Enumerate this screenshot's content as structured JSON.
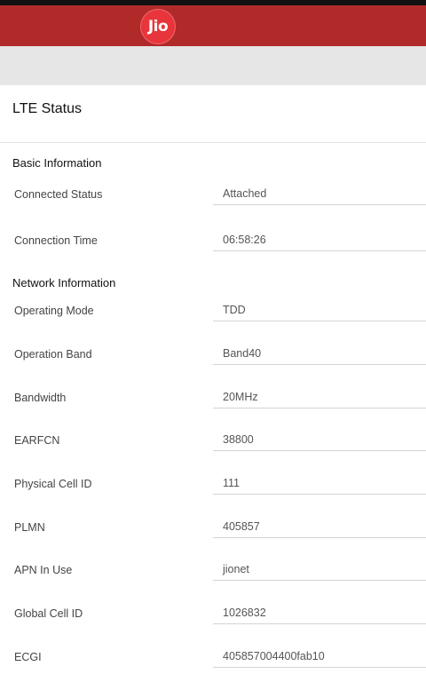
{
  "header": {
    "logo_text": "Jio",
    "brand_color": "#b12a2a",
    "logo_color": "#e8353b"
  },
  "page": {
    "title": "LTE Status"
  },
  "sections": {
    "basic": {
      "title": "Basic Information",
      "rows": [
        {
          "label": "Connected Status",
          "value": "Attached"
        },
        {
          "label": "Connection Time",
          "value": "06:58:26"
        }
      ]
    },
    "network": {
      "title": "Network Information",
      "rows": [
        {
          "label": "Operating Mode",
          "value": "TDD"
        },
        {
          "label": "Operation Band",
          "value": "Band40"
        },
        {
          "label": "Bandwidth",
          "value": "20MHz"
        },
        {
          "label": "EARFCN",
          "value": "38800"
        },
        {
          "label": "Physical Cell ID",
          "value": "111"
        },
        {
          "label": "PLMN",
          "value": "405857"
        },
        {
          "label": "APN In Use",
          "value": "jionet"
        },
        {
          "label": "Global Cell ID",
          "value": "1026832"
        },
        {
          "label": "ECGI",
          "value": "405857004400fab10"
        }
      ]
    }
  }
}
